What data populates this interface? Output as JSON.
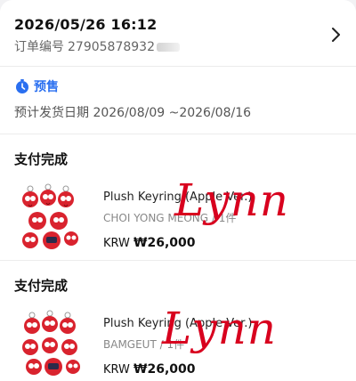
{
  "order": {
    "timestamp": "2026/05/26 16:12",
    "number_label": "订单编号",
    "number_visible": "27905878932"
  },
  "presale": {
    "label": "预售",
    "ship_date": "预计发货日期 2026/08/09 ~2026/08/16"
  },
  "items": [
    {
      "status": "支付完成",
      "name": "Plush Keyring (Apple Ver.)",
      "meta": "CHOI YONG MEONG / 1件",
      "currency": "KRW",
      "price": "₩26,000",
      "watermark": "Lynn"
    },
    {
      "status": "支付完成",
      "name": "Plush Keyring (Apple Ver.)",
      "meta": "BAMGEUT / 1件",
      "currency": "KRW",
      "price": "₩26,000",
      "watermark": "Lynn"
    }
  ],
  "colors": {
    "accent_blue": "#2a6ff0",
    "watermark_red": "#d8001e",
    "plush_red": "#d9232e"
  },
  "icons": {
    "chevron": "chevron-right-icon",
    "presale": "clock-icon"
  }
}
